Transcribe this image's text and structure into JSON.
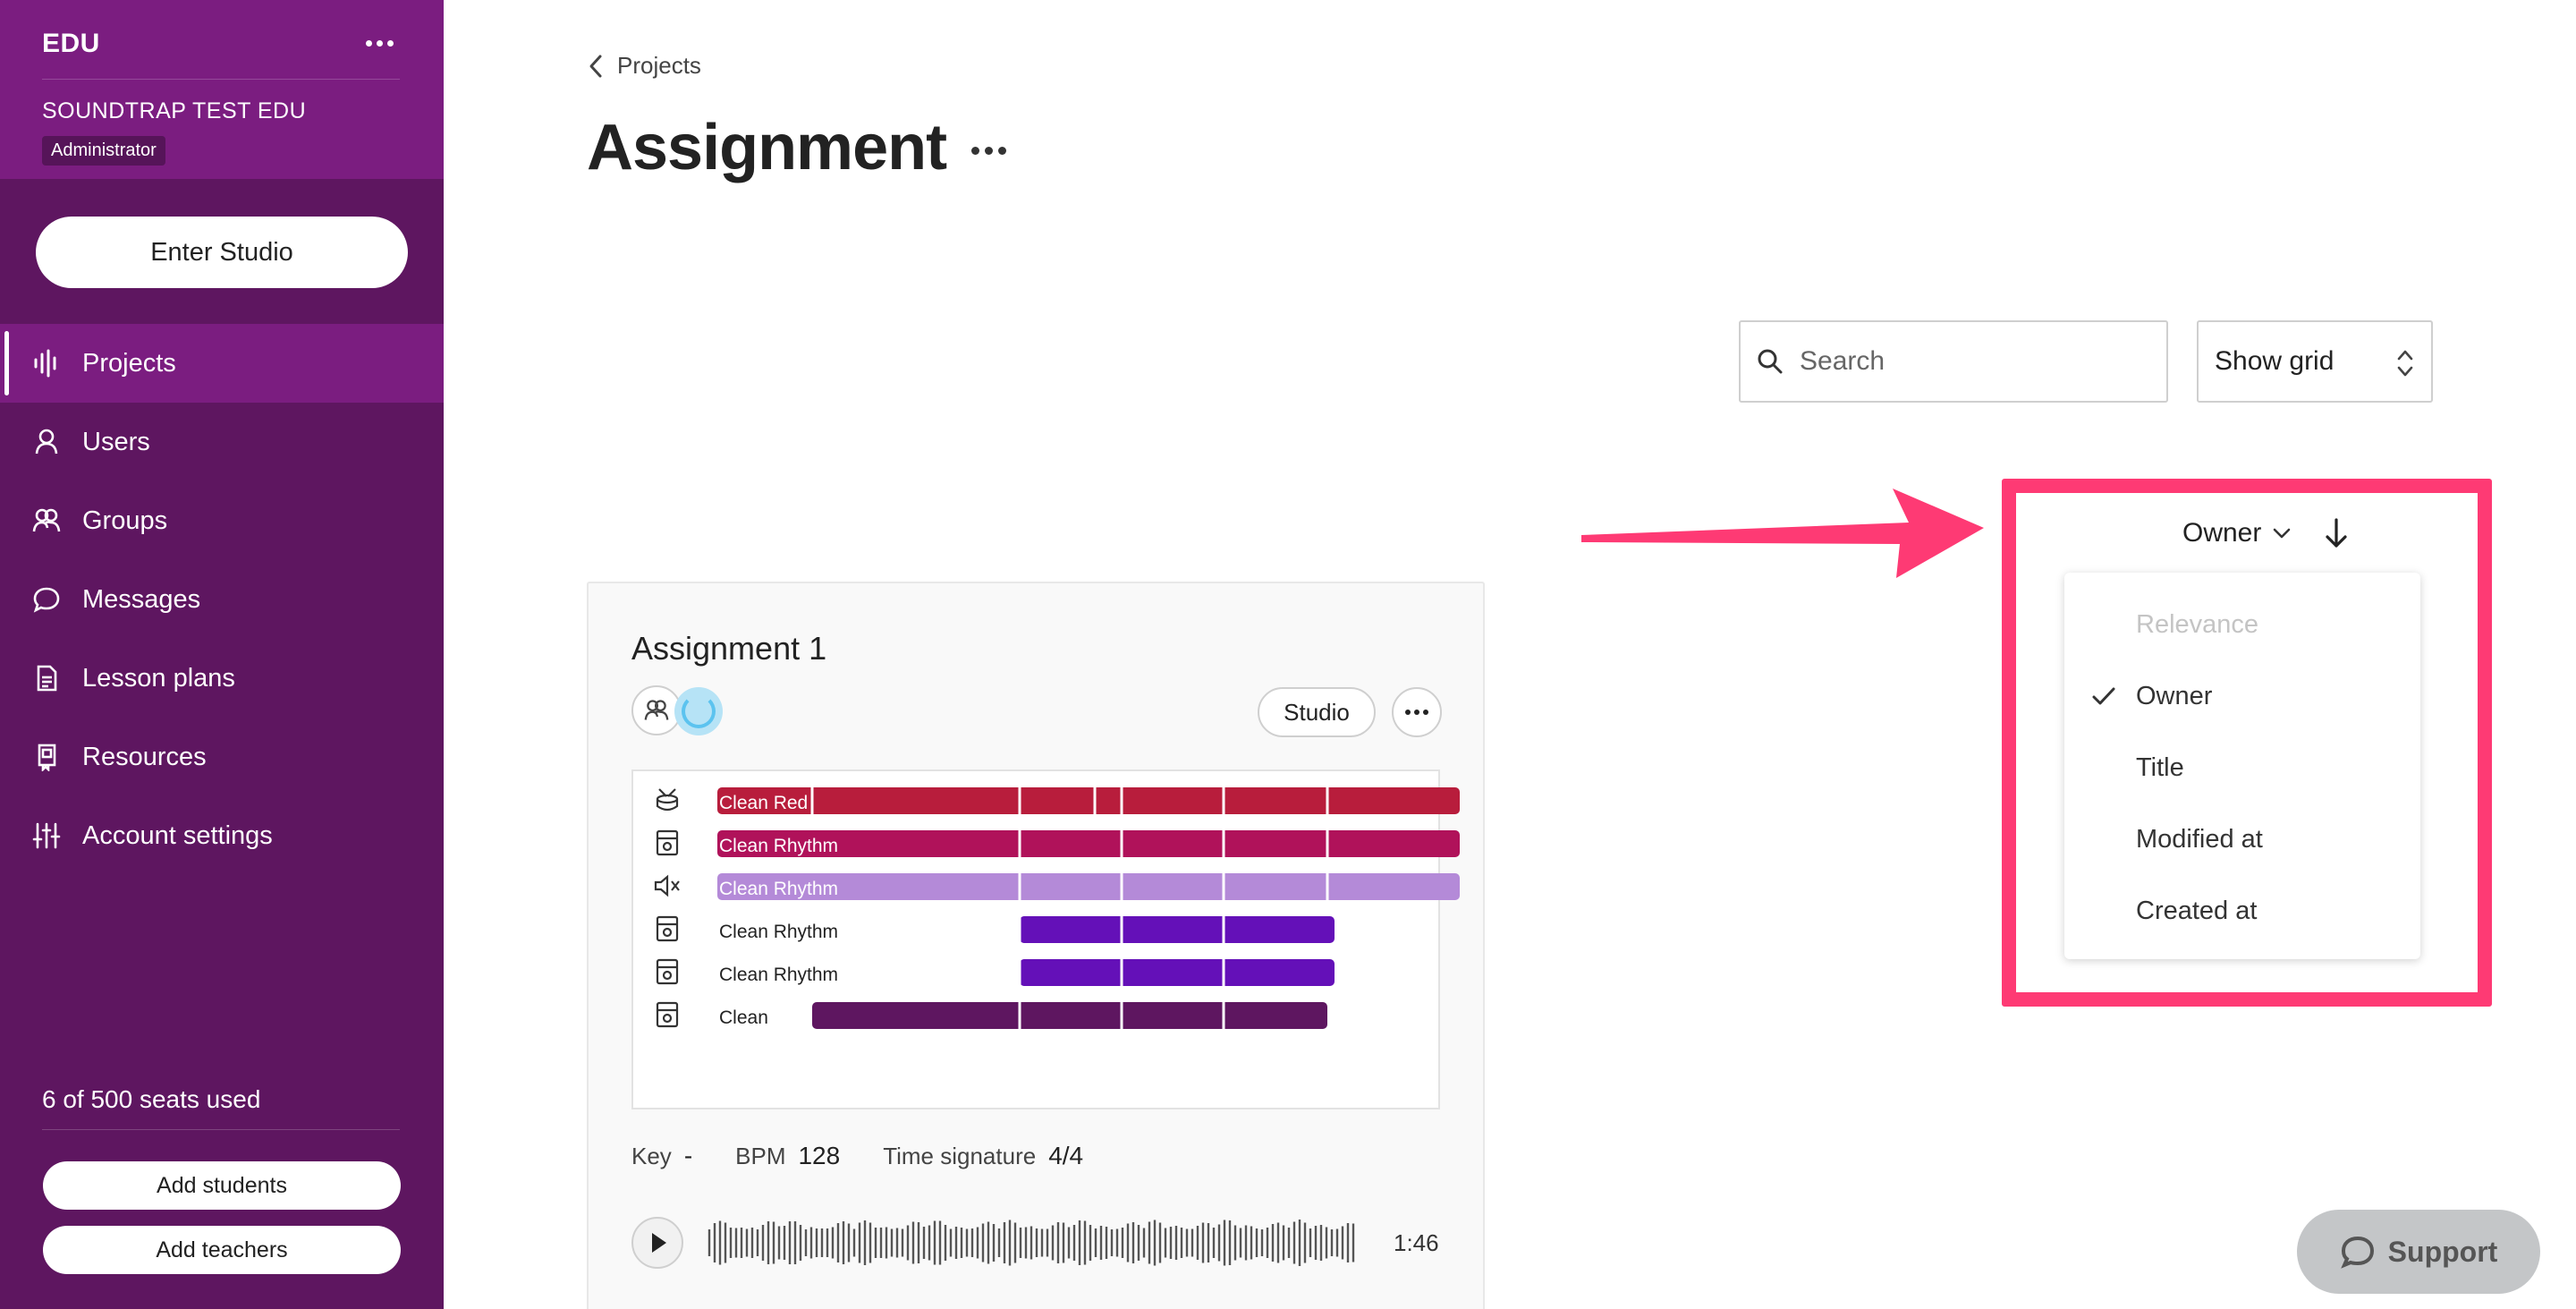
{
  "sidebar": {
    "org": "EDU",
    "school": "SOUNDTRAP TEST EDU",
    "role": "Administrator",
    "enter_studio": "Enter Studio",
    "nav": [
      {
        "label": "Projects",
        "icon": "waveform-icon",
        "active": true
      },
      {
        "label": "Users",
        "icon": "user-icon"
      },
      {
        "label": "Groups",
        "icon": "group-icon"
      },
      {
        "label": "Messages",
        "icon": "chat-bubble-icon"
      },
      {
        "label": "Lesson plans",
        "icon": "document-icon"
      },
      {
        "label": "Resources",
        "icon": "bookmark-icon"
      },
      {
        "label": "Account settings",
        "icon": "sliders-icon"
      }
    ],
    "seats": "6 of 500 seats used",
    "add_students": "Add students",
    "add_teachers": "Add teachers"
  },
  "header": {
    "back_label": "Projects",
    "title": "Assignment"
  },
  "toolbar": {
    "search_placeholder": "Search",
    "view_select": "Show grid"
  },
  "sort": {
    "current": "Owner",
    "direction": "descending",
    "options": [
      {
        "label": "Relevance",
        "disabled": true
      },
      {
        "label": "Owner",
        "selected": true
      },
      {
        "label": "Title"
      },
      {
        "label": "Modified at"
      },
      {
        "label": "Created at"
      }
    ]
  },
  "highlight_color": "#fe3a74",
  "project": {
    "title": "Assignment 1",
    "studio_label": "Studio",
    "tracks": [
      {
        "label": "Clean Red",
        "icon": "drum-icon",
        "color": "#b81d3c"
      },
      {
        "label": "Clean Rhythm",
        "icon": "amp-icon",
        "color": "#b0125a"
      },
      {
        "label": "Clean Rhythm",
        "icon": "speaker-muted-icon",
        "color": "#b48ad8"
      },
      {
        "label": "Clean Rhythm",
        "icon": "amp-icon",
        "color": "#6410b8"
      },
      {
        "label": "Clean Rhythm",
        "icon": "amp-icon",
        "color": "#6410b8"
      },
      {
        "label": "Clean",
        "icon": "amp-icon",
        "color": "#5e1660"
      }
    ],
    "key_label": "Key",
    "key_value": "-",
    "bpm_label": "BPM",
    "bpm_value": "128",
    "time_sig_label": "Time signature",
    "time_sig_value": "4/4",
    "duration": "1:46"
  },
  "support_label": "Support"
}
